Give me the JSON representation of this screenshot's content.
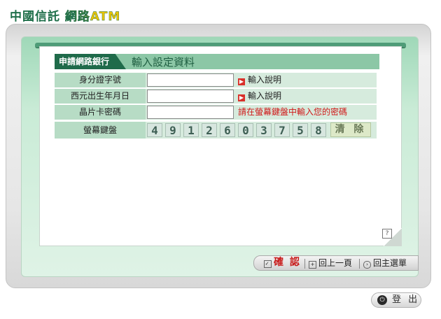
{
  "header": {
    "logo_part1": "中國信託",
    "logo_part2": "網路ATM"
  },
  "panel": {
    "tab_label": "申請網路銀行",
    "title": "輸入設定資料"
  },
  "form": {
    "id_label": "身分證字號",
    "id_value": "",
    "birth_label": "西元出生年月日",
    "birth_value": "",
    "pin_label": "晶片卡密碼",
    "pin_value": "",
    "help_label": "輸入說明",
    "pin_hint": "請在螢幕鍵盤中輸入您的密碼",
    "keypad_label": "螢幕鍵盤"
  },
  "keypad": {
    "keys": [
      "4",
      "9",
      "1",
      "2",
      "6",
      "0",
      "3",
      "7",
      "5",
      "8"
    ],
    "clear": "清 除"
  },
  "buttons": {
    "confirm": "確 認",
    "back": "回上一頁",
    "main_menu": "回主選單",
    "logout": "登 出",
    "help": "?"
  },
  "colors": {
    "brand_green": "#1f6b4a",
    "accent_yellow": "#eac400",
    "warning_red": "#d01818"
  }
}
